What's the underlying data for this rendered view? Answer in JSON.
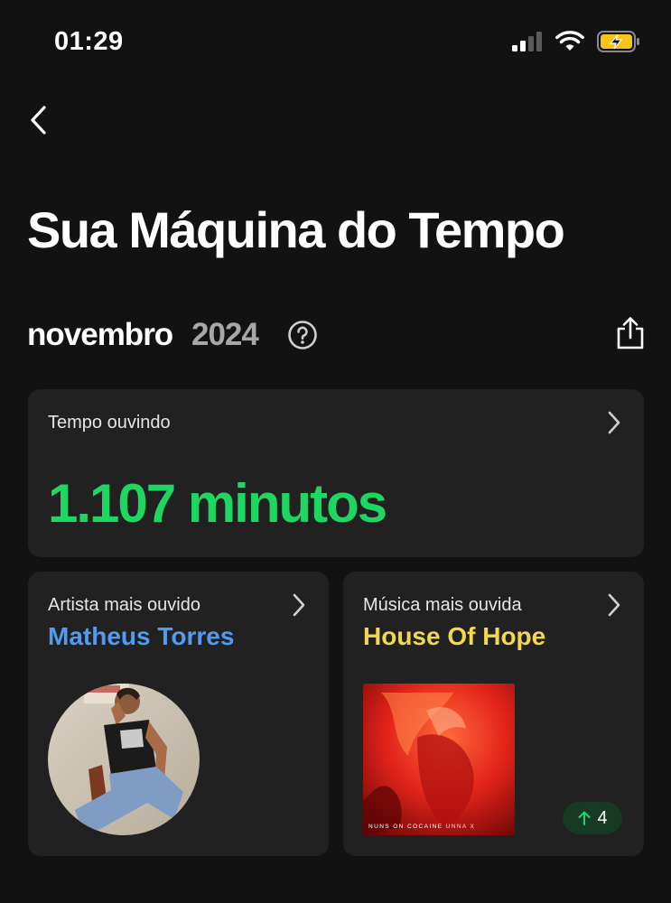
{
  "status_bar": {
    "time": "01:29",
    "icons": [
      "cellular-signal-icon",
      "wifi-icon",
      "battery-charging-icon"
    ],
    "battery_color": "#f5c518"
  },
  "nav": {
    "back_icon": "chevron-left-icon"
  },
  "page": {
    "title": "Sua Máquina do Tempo"
  },
  "period": {
    "month": "novembro",
    "year": "2024",
    "help_icon": "question-circle-icon",
    "share_icon": "share-icon"
  },
  "listening_time": {
    "label": "Tempo ouvindo",
    "value": "1.107 minutos",
    "color": "#1ed760"
  },
  "top_artist": {
    "label": "Artista mais ouvido",
    "name": "Matheus Torres",
    "color": "#509bf5"
  },
  "top_song": {
    "label": "Música mais ouvida",
    "name": "House Of Hope",
    "color": "#f2d94b",
    "cover_title": "NUNS ON COCAINE",
    "cover_artist": "UNNA X",
    "rank_change": "4",
    "rank_icon": "arrow-up-icon"
  }
}
